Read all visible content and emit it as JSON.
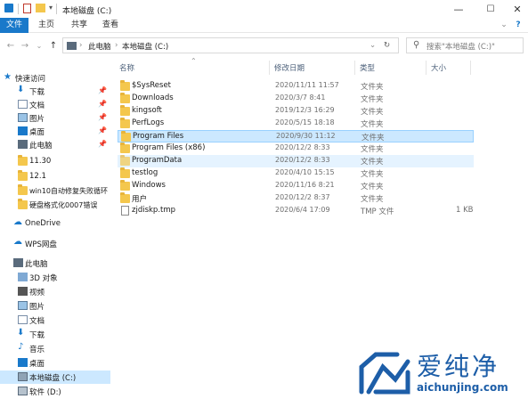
{
  "window": {
    "title": "本地磁盘 (C:)",
    "minimize": "—",
    "maximize": "☐",
    "close": "✕"
  },
  "ribbon": {
    "tabs": [
      "文件",
      "主页",
      "共享",
      "查看"
    ]
  },
  "address": {
    "segments": [
      "此电脑",
      "本地磁盘 (C:)"
    ],
    "search_placeholder": "搜索\"本地磁盘 (C:)\""
  },
  "nav": {
    "quick_access": "快速访问",
    "pinned": [
      "下载",
      "文档",
      "图片",
      "桌面",
      "此电脑"
    ],
    "folders": [
      "11.30",
      "12.1",
      "win10自动修复失败循环",
      "硬盘格式化0007错误"
    ],
    "onedrive": "OneDrive",
    "wps": "WPS网盘",
    "this_pc": "此电脑",
    "pc_items": [
      "3D 对象",
      "视频",
      "图片",
      "文档",
      "下载",
      "音乐",
      "桌面",
      "本地磁盘 (C:)",
      "软件 (D:)"
    ]
  },
  "columns": {
    "name": "名称",
    "date": "修改日期",
    "type": "类型",
    "size": "大小"
  },
  "files": [
    {
      "name": "$SysReset",
      "date": "2020/11/11 11:57",
      "type": "文件夹",
      "size": ""
    },
    {
      "name": "Downloads",
      "date": "2020/3/7 8:41",
      "type": "文件夹",
      "size": ""
    },
    {
      "name": "kingsoft",
      "date": "2019/12/3 16:29",
      "type": "文件夹",
      "size": ""
    },
    {
      "name": "PerfLogs",
      "date": "2020/5/15 18:18",
      "type": "文件夹",
      "size": ""
    },
    {
      "name": "Program Files",
      "date": "2020/9/30 11:12",
      "type": "文件夹",
      "size": ""
    },
    {
      "name": "Program Files (x86)",
      "date": "2020/12/2 8:33",
      "type": "文件夹",
      "size": ""
    },
    {
      "name": "ProgramData",
      "date": "2020/12/2 8:33",
      "type": "文件夹",
      "size": ""
    },
    {
      "name": "testlog",
      "date": "2020/4/10 15:15",
      "type": "文件夹",
      "size": ""
    },
    {
      "name": "Windows",
      "date": "2020/11/16 8:21",
      "type": "文件夹",
      "size": ""
    },
    {
      "name": "用户",
      "date": "2020/12/2 8:37",
      "type": "文件夹",
      "size": ""
    },
    {
      "name": "zjdiskp.tmp",
      "date": "2020/6/4 17:09",
      "type": "TMP 文件",
      "size": "1 KB"
    }
  ],
  "watermark": {
    "text": "爱纯净",
    "url": "aichunjing.com"
  }
}
